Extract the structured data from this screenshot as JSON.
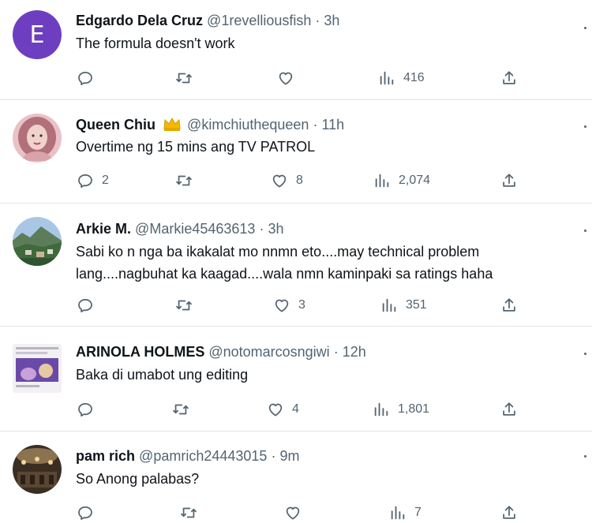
{
  "tweets": [
    {
      "name": "Edgardo Dela Cruz",
      "handle": "@1revelliousfish",
      "time": "3h",
      "text": "The formula doesn't work",
      "avatar_letter": "E",
      "replies": "",
      "retweets": "",
      "likes": "",
      "views": "416"
    },
    {
      "name": "Queen Chiu",
      "handle": "@kimchiuthequeen",
      "time": "11h",
      "text": "Overtime ng 15 mins ang TV PATROL",
      "replies": "2",
      "retweets": "",
      "likes": "8",
      "views": "2,074"
    },
    {
      "name": "Arkie M.",
      "handle": "@Markie45463613",
      "time": "3h",
      "text": "Sabi ko n nga ba ikakalat mo nnmn eto....may technical problem lang....nagbuhat ka kaagad....wala nmn kaminpaki sa ratings haha",
      "replies": "",
      "retweets": "",
      "likes": "3",
      "views": "351"
    },
    {
      "name": "ARINOLA HOLMES",
      "handle": "@notomarcosngiwi",
      "time": "12h",
      "text": "Baka di umabot ung editing",
      "replies": "",
      "retweets": "",
      "likes": "4",
      "views": "1,801"
    },
    {
      "name": "pam rich",
      "handle": "@pamrich24443015",
      "time": "9m",
      "text": "So Anong palabas?",
      "replies": "",
      "retweets": "",
      "likes": "",
      "views": "7"
    }
  ],
  "separator": "·",
  "icons": [
    "reply-icon",
    "retweet-icon",
    "like-icon",
    "views-icon",
    "share-icon",
    "more-icon",
    "crown-icon"
  ],
  "colors": {
    "text": "#0f1419",
    "muted": "#536471",
    "divider": "#dfe3e7",
    "avatar_purple": "#6d3fc0"
  }
}
